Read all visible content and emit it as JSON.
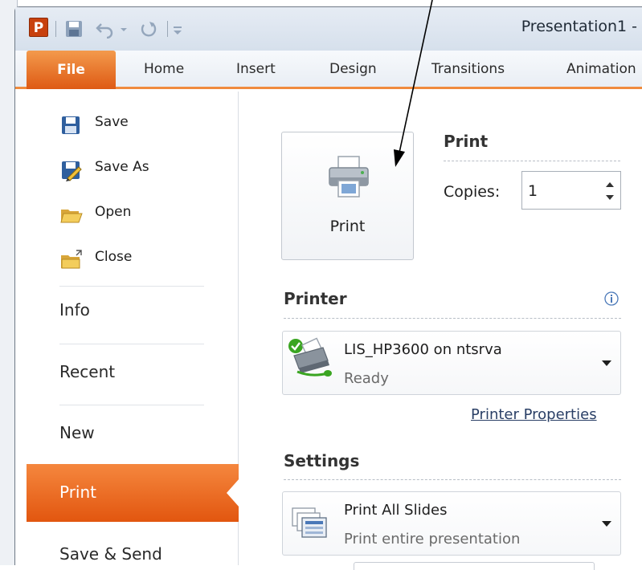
{
  "window": {
    "title": "Presentation1 -",
    "app_logo_letter": "P"
  },
  "ribbon": {
    "tabs": [
      {
        "label": "File"
      },
      {
        "label": "Home"
      },
      {
        "label": "Insert"
      },
      {
        "label": "Design"
      },
      {
        "label": "Transitions"
      },
      {
        "label": "Animation"
      }
    ]
  },
  "nav": {
    "commands": [
      {
        "label": "Save",
        "icon": "save-icon"
      },
      {
        "label": "Save As",
        "icon": "save-as-icon"
      },
      {
        "label": "Open",
        "icon": "open-folder-icon"
      },
      {
        "label": "Close",
        "icon": "close-folder-icon"
      }
    ],
    "tabs": [
      {
        "label": "Info"
      },
      {
        "label": "Recent"
      },
      {
        "label": "New"
      },
      {
        "label": "Print",
        "selected": true
      },
      {
        "label": "Save & Send"
      }
    ]
  },
  "print": {
    "button_label": "Print",
    "heading": "Print",
    "copies_label": "Copies:",
    "copies_value": "1"
  },
  "printer": {
    "heading": "Printer",
    "name": "LIS_HP3600 on ntsrva",
    "status": "Ready",
    "properties_link": "Printer Properties"
  },
  "settings": {
    "heading": "Settings",
    "slides_main": "Print All Slides",
    "slides_sub": "Print entire presentation"
  },
  "colors": {
    "accent_orange": "#e2560f",
    "ready_check": "#3aa521"
  }
}
